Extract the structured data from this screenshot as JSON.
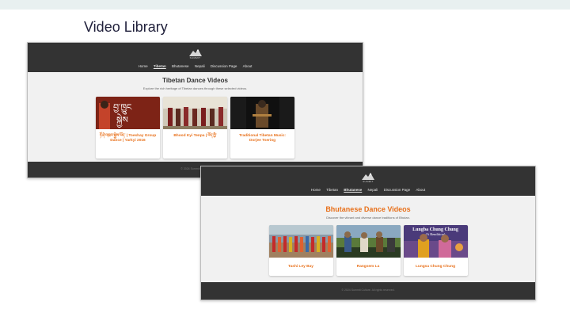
{
  "slide": {
    "title": "Video Library"
  },
  "colors": {
    "accent": "#e8701a",
    "nav_bg": "#333333",
    "page_bg": "#f1f1f1"
  },
  "shot1": {
    "logo_text": "SUMMIT",
    "nav": [
      {
        "label": "Home",
        "active": false
      },
      {
        "label": "Tibetan",
        "active": true
      },
      {
        "label": "Bhutanese",
        "active": false
      },
      {
        "label": "Nepali",
        "active": false
      },
      {
        "label": "Discussion Page",
        "active": false
      },
      {
        "label": "About",
        "active": false
      }
    ],
    "heading": "Tibetan Dance Videos",
    "subheading": "Explore the rich heritage of Tibetan dances through these selected videos.",
    "cards": [
      {
        "title": "ཏོ་ཤེ་འཁྲབ་སྐྱེས་ཡོད་ | Toeshay Group Dance | Yarkyi 2016"
      },
      {
        "title": "Bhood Kyi Tenpa | བོད་ཀྱི་"
      },
      {
        "title": "Traditional Tibetan Music: Dorjee Tsering"
      }
    ],
    "footer": "© 2024 Summit Culture"
  },
  "shot2": {
    "logo_text": "SUMMIT",
    "nav": [
      {
        "label": "Home",
        "active": false
      },
      {
        "label": "Tibetan",
        "active": false
      },
      {
        "label": "Bhutanese",
        "active": true
      },
      {
        "label": "Nepali",
        "active": false
      },
      {
        "label": "Discussion Page",
        "active": false
      },
      {
        "label": "About",
        "active": false
      }
    ],
    "heading": "Bhutanese Dance Videos",
    "subheading": "Discover the vibrant and diverse dance traditions of Bhutan.",
    "cards": [
      {
        "title": "Tashi Ley Bay"
      },
      {
        "title": "Rangsem La"
      },
      {
        "title": "Lungsa Chung Chung"
      }
    ],
    "thumb_overlay": "Lungba Chung Chung\n(A Rendition)",
    "footer": "© 2024 Summit Culture. All rights reserved."
  }
}
